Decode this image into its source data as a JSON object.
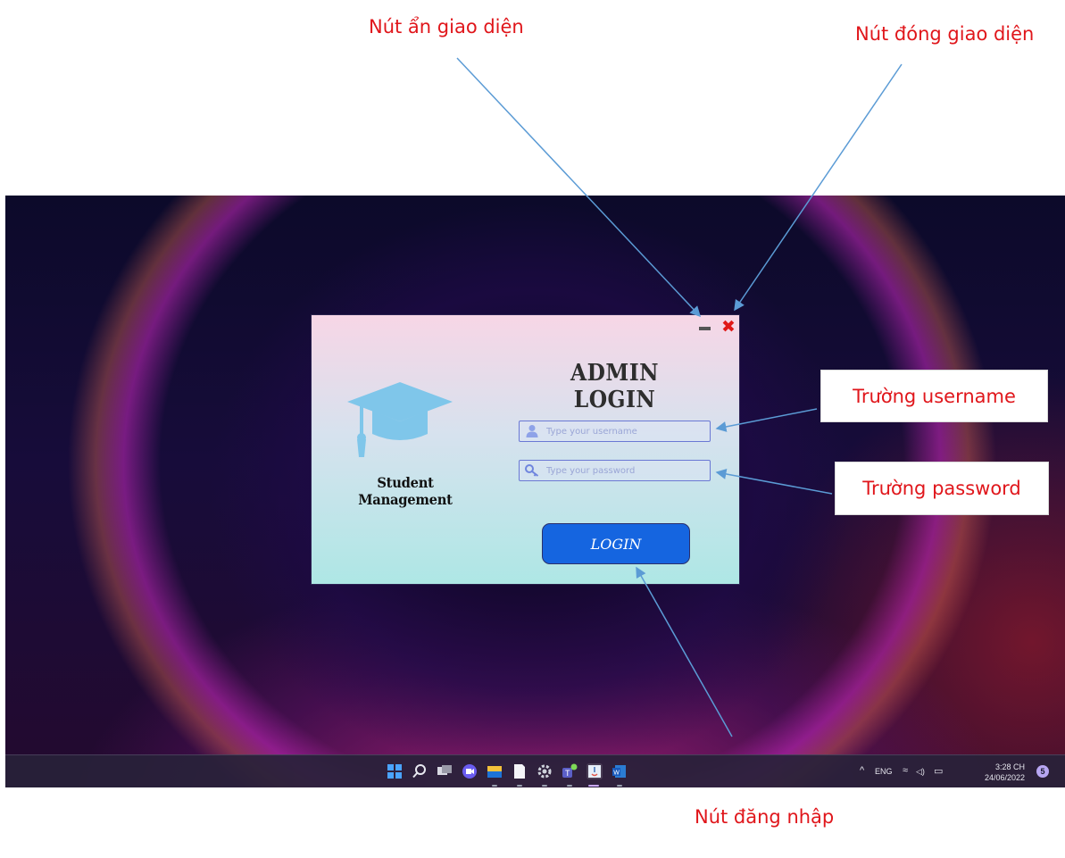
{
  "annotations": {
    "minimize_label": "Nút ẩn giao diện",
    "close_label": "Nút đóng  giao diện",
    "username_label": "Trường username",
    "password_label": "Trường password",
    "login_label": "Nút đăng nhập",
    "label_color": "#e0161b",
    "arrow_color": "#5b9bd5"
  },
  "login_window": {
    "app_name": "Student Management",
    "heading": "ADMIN  LOGIN",
    "username_placeholder": "Type your username",
    "password_placeholder": "Type your password",
    "login_button": "LOGIN",
    "minimize_icon": "minimize-icon",
    "close_icon": "close-icon",
    "close_glyph": "✖",
    "logo_icon": "graduation-cap-icon",
    "username_icon": "user-icon",
    "password_icon": "key-icon",
    "button_color": "#1565e0"
  },
  "taskbar": {
    "icons": [
      "windows-start-icon",
      "search-icon",
      "task-view-icon",
      "chat-icon",
      "file-explorer-icon",
      "notepad-icon",
      "settings-icon",
      "teams-icon",
      "java-app-icon",
      "word-icon"
    ],
    "tray": {
      "chevron": "^",
      "language": "ENG",
      "wifi_glyph": "≈",
      "volume_glyph": "◁)",
      "battery_glyph": "▭"
    },
    "time": "3:28 CH",
    "date": "24/06/2022",
    "notification_count": "5"
  }
}
